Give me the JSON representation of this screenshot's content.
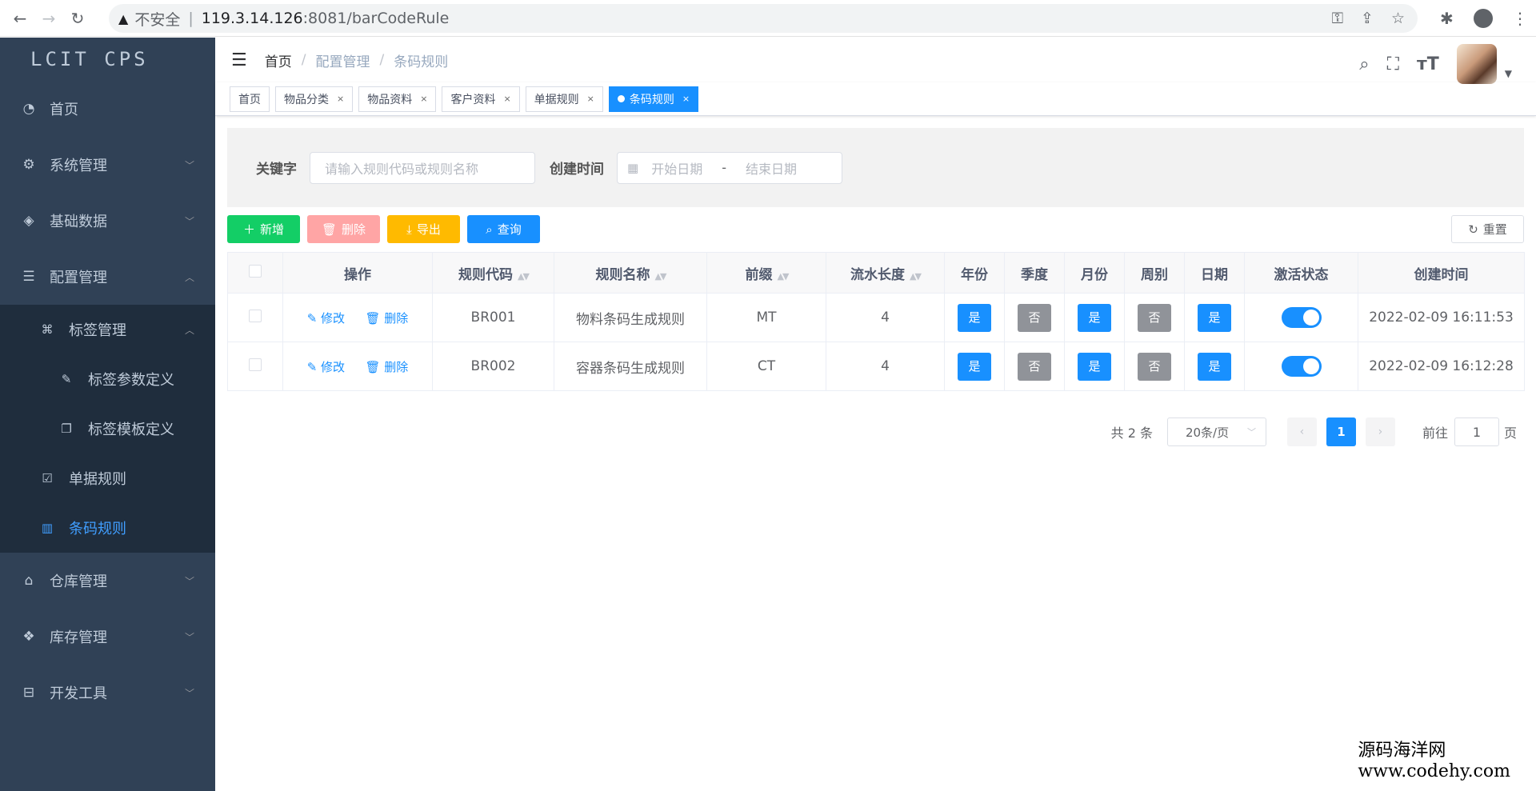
{
  "browser": {
    "insecure_label": "不安全",
    "url_host": "119.3.14.126",
    "url_rest": ":8081/barCodeRule"
  },
  "sidebar": {
    "logo": "LCIT CPS",
    "items": {
      "home": "首页",
      "system": "系统管理",
      "basic": "基础数据",
      "config": "配置管理",
      "label_mgmt": "标签管理",
      "label_param": "标签参数定义",
      "label_tpl": "标签模板定义",
      "doc_rule": "单据规则",
      "barcode_rule": "条码规则",
      "warehouse": "仓库管理",
      "inventory": "库存管理",
      "devtools": "开发工具"
    }
  },
  "breadcrumb": [
    "首页",
    "配置管理",
    "条码规则"
  ],
  "tags": [
    {
      "label": "首页"
    },
    {
      "label": "物品分类"
    },
    {
      "label": "物品资料"
    },
    {
      "label": "客户资料"
    },
    {
      "label": "单据规则"
    },
    {
      "label": "条码规则"
    }
  ],
  "search": {
    "keyword_label": "关键字",
    "keyword_placeholder": "请输入规则代码或规则名称",
    "created_label": "创建时间",
    "start_placeholder": "开始日期",
    "end_placeholder": "结束日期",
    "range_sep": "-"
  },
  "toolbar": {
    "add": "新增",
    "delete": "删除",
    "export": "导出",
    "query": "查询",
    "reset": "重置"
  },
  "table": {
    "headers": {
      "ops": "操作",
      "code": "规则代码",
      "name": "规则名称",
      "prefix": "前缀",
      "serial_len": "流水长度",
      "year": "年份",
      "quarter": "季度",
      "month": "月份",
      "week": "周别",
      "day": "日期",
      "active": "激活状态",
      "created": "创建时间"
    },
    "op_edit": "修改",
    "op_delete": "删除",
    "rows": [
      {
        "code": "BR001",
        "name": "物料条码生成规则",
        "prefix": "MT",
        "serial_len": "4",
        "year": "是",
        "quarter": "否",
        "month": "是",
        "week": "否",
        "day": "是",
        "active": true,
        "created": "2022-02-09 16:11:53"
      },
      {
        "code": "BR002",
        "name": "容器条码生成规则",
        "prefix": "CT",
        "serial_len": "4",
        "year": "是",
        "quarter": "否",
        "month": "是",
        "week": "否",
        "day": "是",
        "active": true,
        "created": "2022-02-09 16:12:28"
      }
    ]
  },
  "pager": {
    "total": "共 2 条",
    "page_size": "20条/页",
    "current": "1",
    "goto_label": "前往",
    "goto_value": "1",
    "page_suffix": "页"
  },
  "watermark": {
    "line1": "源码海洋网",
    "line2": "www.codehy.com"
  },
  "colors": {
    "sidebar_bg": "#304156",
    "submenu_bg": "#1f2d3d",
    "primary": "#1890ff",
    "success": "#13ce66",
    "danger_light": "#ffa5a5",
    "warning": "#ffba00",
    "info_gray": "#909399"
  }
}
